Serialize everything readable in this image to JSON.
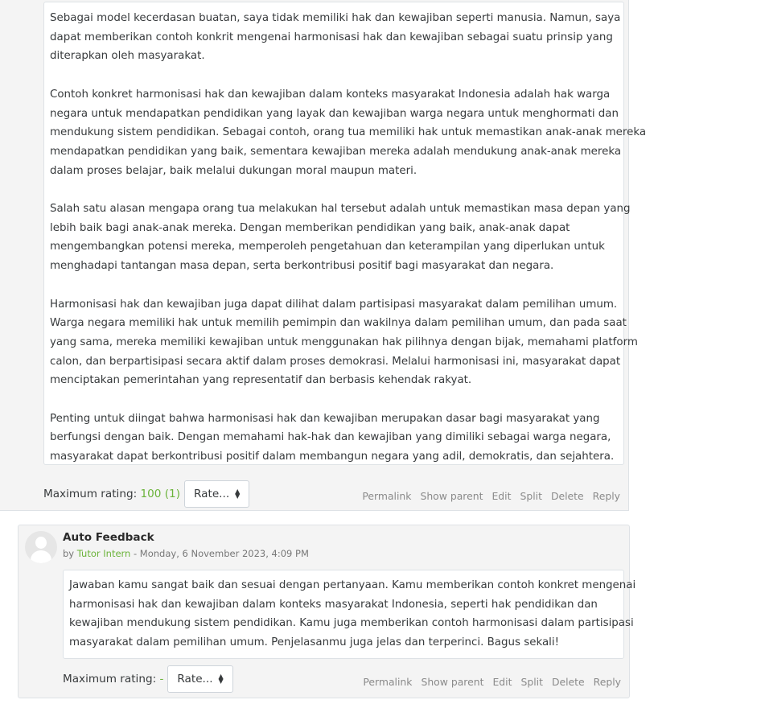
{
  "post1": {
    "paragraphs": [
      [
        "Sebagai model kecerdasan buatan, saya tidak memiliki hak dan kewajiban seperti manusia. Namun, saya",
        "dapat memberikan contoh konkrit mengenai harmonisasi hak dan kewajiban sebagai suatu prinsip yang",
        "diterapkan oleh masyarakat."
      ],
      [
        "Contoh konkret harmonisasi hak dan kewajiban dalam konteks masyarakat Indonesia adalah hak warga",
        "negara untuk mendapatkan pendidikan yang layak dan kewajiban warga negara untuk menghormati dan",
        "mendukung sistem pendidikan. Sebagai contoh, orang tua memiliki hak untuk memastikan anak-anak mereka",
        "mendapatkan pendidikan yang baik, sementara kewajiban mereka adalah mendukung anak-anak mereka",
        "dalam proses belajar, baik melalui dukungan moral maupun materi."
      ],
      [
        "Salah satu alasan mengapa orang tua melakukan hal tersebut adalah untuk memastikan masa depan yang",
        "lebih baik bagi anak-anak mereka. Dengan memberikan pendidikan yang baik, anak-anak dapat",
        "mengembangkan potensi mereka, memperoleh pengetahuan dan keterampilan yang diperlukan untuk",
        "menghadapi tantangan masa depan, serta berkontribusi positif bagi masyarakat dan negara."
      ],
      [
        "Harmonisasi hak dan kewajiban juga dapat dilihat dalam partisipasi masyarakat dalam pemilihan umum.",
        "Warga negara memiliki hak untuk memilih pemimpin dan wakilnya dalam pemilihan umum, dan pada saat",
        "yang sama, mereka memiliki kewajiban untuk menggunakan hak pilihnya dengan bijak, memahami platform",
        "calon, dan berpartisipasi secara aktif dalam proses demokrasi. Melalui harmonisasi ini, masyarakat dapat",
        "menciptakan pemerintahan yang representatif dan berbasis kehendak rakyat."
      ],
      [
        "Penting untuk diingat bahwa harmonisasi hak dan kewajiban merupakan dasar bagi masyarakat yang",
        "berfungsi dengan baik. Dengan memahami hak-hak dan kewajiban yang dimiliki sebagai warga negara,",
        "masyarakat dapat berkontribusi positif dalam membangun negara yang adil, demokratis, dan sejahtera."
      ]
    ],
    "rating_label": "Maximum rating:",
    "rating_value": "100 (1)",
    "rate_select": "Rate...",
    "actions": [
      "Permalink",
      "Show parent",
      "Edit",
      "Split",
      "Delete",
      "Reply"
    ]
  },
  "post2": {
    "avatar_icon": "user-avatar-placeholder",
    "title": "Auto Feedback",
    "by": "by",
    "author": "Tutor Intern",
    "date": " - Monday, 6 November 2023, 4:09 PM",
    "paragraphs": [
      [
        "Jawaban kamu sangat baik dan sesuai dengan pertanyaan. Kamu memberikan contoh konkret mengenai",
        "harmonisasi hak dan kewajiban dalam konteks masyarakat Indonesia, seperti hak pendidikan dan",
        "kewajiban mendukung sistem pendidikan. Kamu juga memberikan contoh harmonisasi dalam partisipasi",
        "masyarakat dalam pemilihan umum. Penjelasanmu juga jelas dan terperinci. Bagus sekali!"
      ]
    ],
    "rating_label": "Maximum rating:",
    "rating_value": "-",
    "rate_select": "Rate...",
    "actions": [
      "Permalink",
      "Show parent",
      "Edit",
      "Split",
      "Delete",
      "Reply"
    ]
  },
  "colors": {
    "accent": "#6bb33a",
    "link_muted": "#8a8a8a",
    "panel": "#f4f4f4"
  }
}
